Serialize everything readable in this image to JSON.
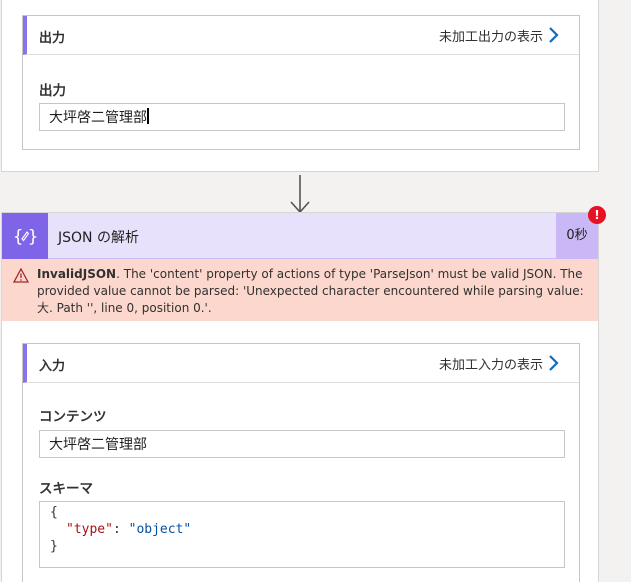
{
  "output_section": {
    "title": "出力",
    "raw_link": "未加工出力の表示",
    "field_label": "出力",
    "field_value": "大坪啓二管理部"
  },
  "action": {
    "title": "JSON の解析",
    "duration": "0秒",
    "error_badge": "!",
    "error": {
      "code": "InvalidJSON",
      "message": ". The 'content' property of actions of type 'ParseJson' must be valid JSON. The provided value cannot be parsed: 'Unexpected character encountered while parsing value: 大. Path '', line 0, position 0.'."
    }
  },
  "input_section": {
    "title": "入力",
    "raw_link": "未加工入力の表示",
    "content_label": "コンテンツ",
    "content_value": "大坪啓二管理部",
    "schema_label": "スキーマ",
    "schema": {
      "open": "{",
      "key": "\"type\"",
      "sep": ": ",
      "value": "\"object\"",
      "close": "}"
    }
  },
  "colors": {
    "accent": "#8064e8",
    "header_bg": "#e7e1fb",
    "error_bg": "#fbd7cd",
    "error_badge": "#e81123",
    "link_chevron": "#0f6cbd"
  }
}
